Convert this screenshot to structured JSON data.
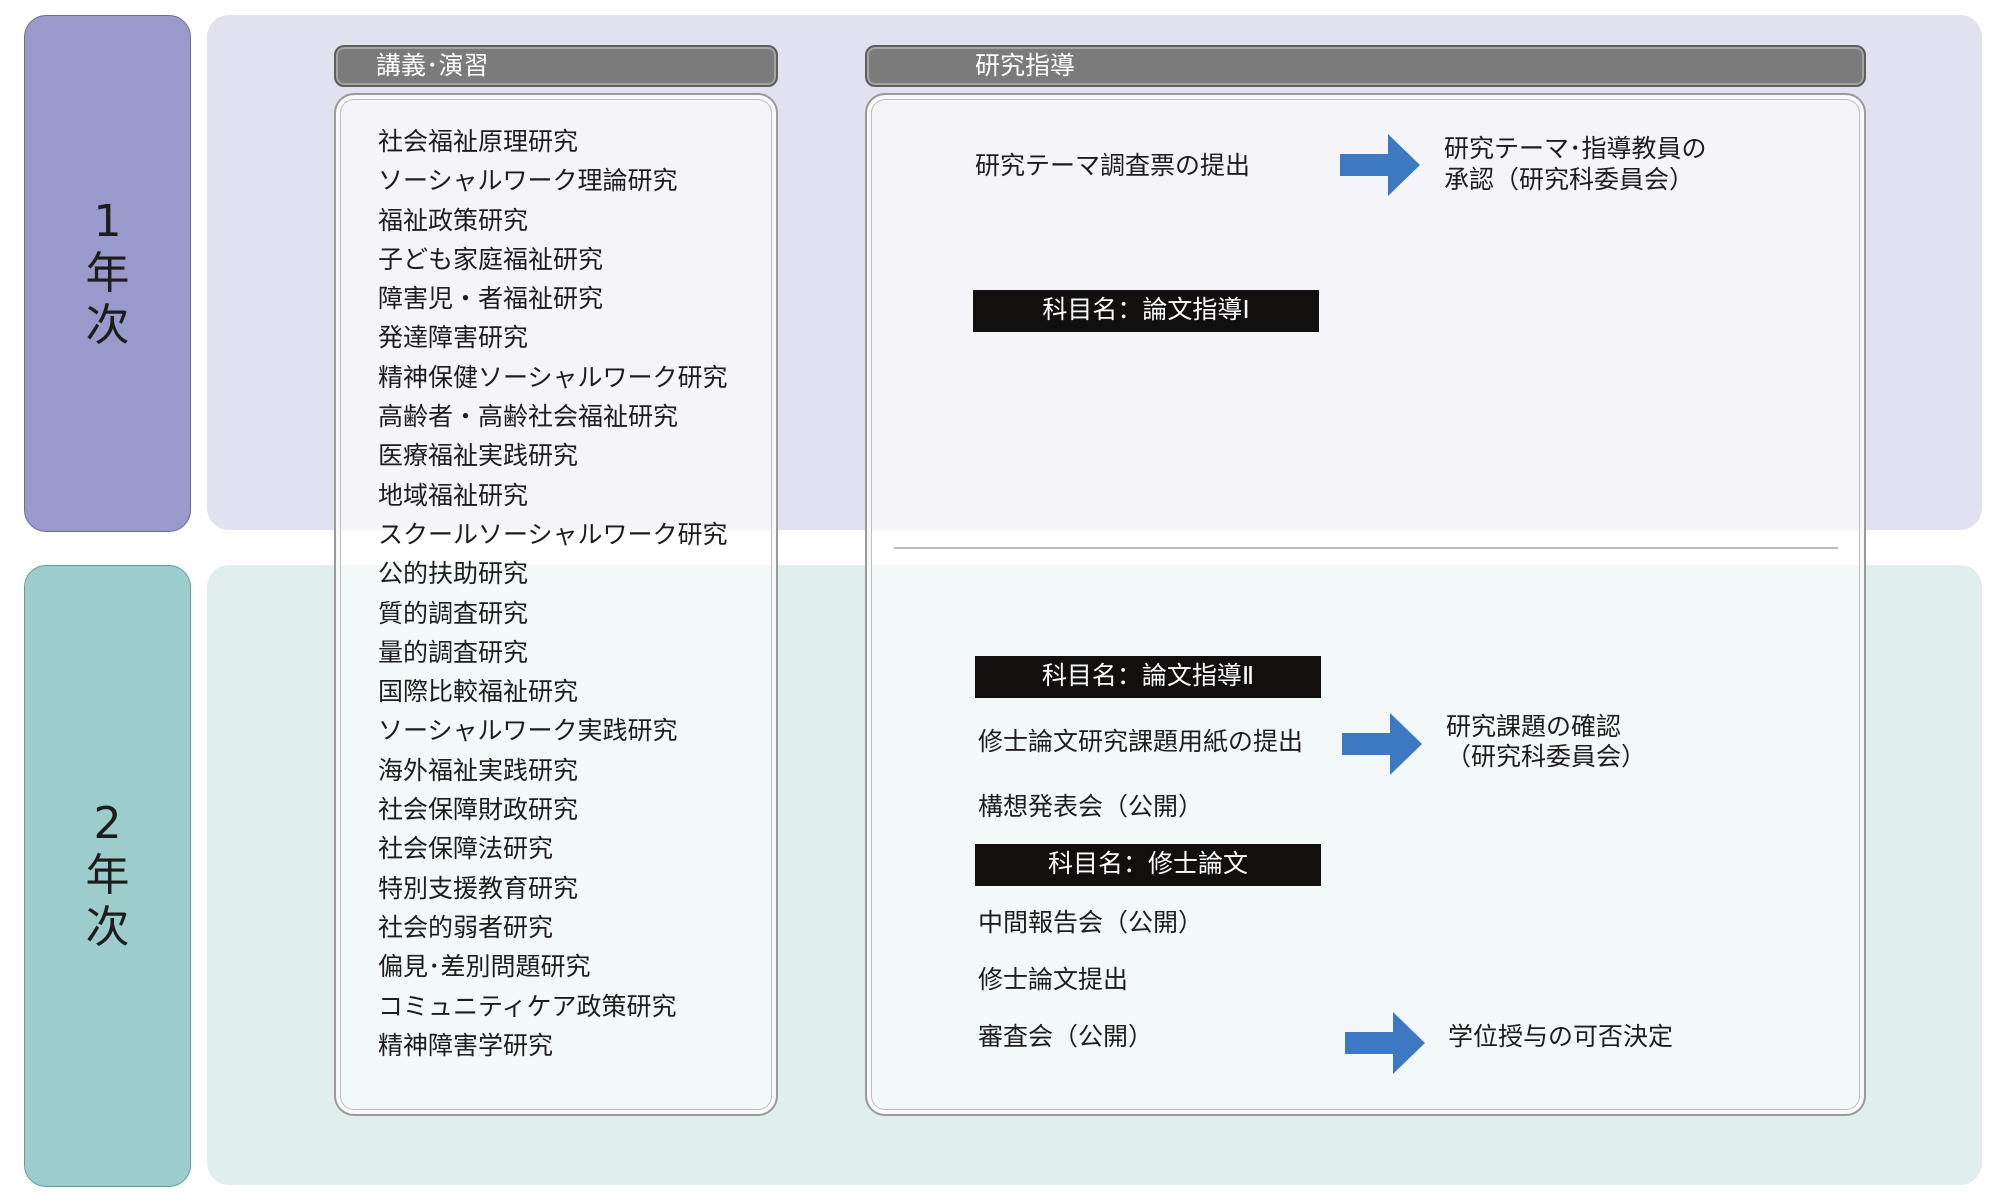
{
  "years": {
    "first": "1年次",
    "second": "2年次"
  },
  "columns": {
    "lectures": "講義･演習",
    "research": "研究指導"
  },
  "courses": [
    "社会福祉原理研究",
    "ソーシャルワーク理論研究",
    "福祉政策研究",
    "子ども家庭福祉研究",
    "障害児・者福祉研究",
    "発達障害研究",
    "精神保健ソーシャルワーク研究",
    "高齢者・高齢社会福祉研究",
    "医療福祉実践研究",
    "地域福祉研究",
    "スクールソーシャルワーク研究",
    "公的扶助研究",
    "質的調査研究",
    "量的調査研究",
    "国際比較福祉研究",
    "ソーシャルワーク実践研究",
    "海外福祉実践研究",
    "社会保障財政研究",
    "社会保障法研究",
    "特別支援教育研究",
    "社会的弱者研究",
    "偏見･差別問題研究",
    "コミュニティケア政策研究",
    "精神障害学研究"
  ],
  "research": {
    "y1": {
      "step1": "研究テーマ調査票の提出",
      "result1_line1": "研究テーマ･指導教員の",
      "result1_line2": "承認（研究科委員会）",
      "subject": "科目名：論文指導Ⅰ"
    },
    "y2": {
      "subject1": "科目名：論文指導Ⅱ",
      "step1": "修士論文研究課題用紙の提出",
      "result1_line1": "研究課題の確認",
      "result1_line2": "（研究科委員会）",
      "step2": "構想発表会（公開）",
      "subject2": "科目名：修士論文",
      "step3": "中間報告会（公開）",
      "step4": "修士論文提出",
      "step5": "審査会（公開）",
      "result2": "学位授与の可否決定"
    }
  },
  "colors": {
    "year1_band": "#e2e1f0",
    "year1_label": "#9a99cc",
    "year2_band": "#e0efee",
    "year2_label": "#9ccccb",
    "arrow": "#3d78c2",
    "subject_box": "#120f0f",
    "tab": "#7b7b7b"
  }
}
